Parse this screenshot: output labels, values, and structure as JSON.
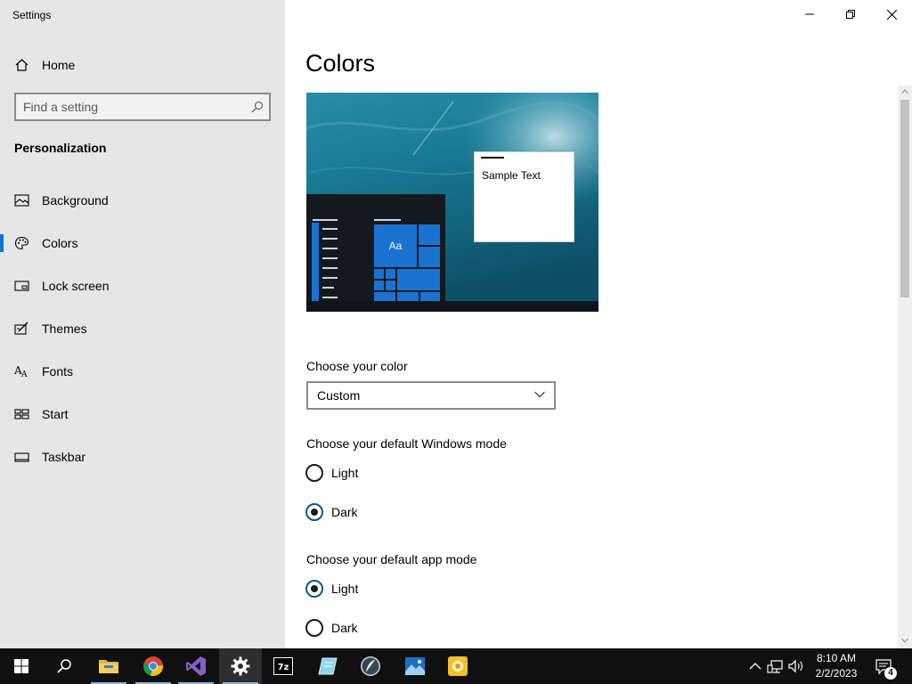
{
  "app": {
    "title": "Settings"
  },
  "window_controls": {
    "minimize": "minimize",
    "restore": "restore",
    "close": "close"
  },
  "sidebar": {
    "home_label": "Home",
    "search_placeholder": "Find a setting",
    "section_title": "Personalization",
    "items": [
      {
        "label": "Background",
        "icon": "picture-icon"
      },
      {
        "label": "Colors",
        "icon": "palette-icon",
        "selected": true
      },
      {
        "label": "Lock screen",
        "icon": "lock-screen-icon"
      },
      {
        "label": "Themes",
        "icon": "themes-icon"
      },
      {
        "label": "Fonts",
        "icon": "fonts-icon"
      },
      {
        "label": "Start",
        "icon": "start-icon"
      },
      {
        "label": "Taskbar",
        "icon": "taskbar-icon"
      }
    ],
    "accent_color": "#0078d4"
  },
  "main": {
    "title": "Colors",
    "preview": {
      "sample_text": "Sample Text",
      "tile_text": "Aa"
    },
    "choose_color": {
      "label": "Choose your color",
      "value": "Custom"
    },
    "windows_mode": {
      "label": "Choose your default Windows mode",
      "options": [
        "Light",
        "Dark"
      ],
      "selected": "Dark"
    },
    "app_mode": {
      "label": "Choose your default app mode",
      "options": [
        "Light",
        "Dark"
      ],
      "selected": "Light"
    }
  },
  "taskbar": {
    "apps": [
      "start-button",
      "search",
      "file-explorer",
      "chrome",
      "visual-studio",
      "settings",
      "7-zip",
      "app-notepad",
      "app-feather",
      "photos",
      "app-yellow"
    ],
    "clock": {
      "time": "8:10 AM",
      "date": "2/2/2023"
    },
    "notification_count": "4"
  }
}
